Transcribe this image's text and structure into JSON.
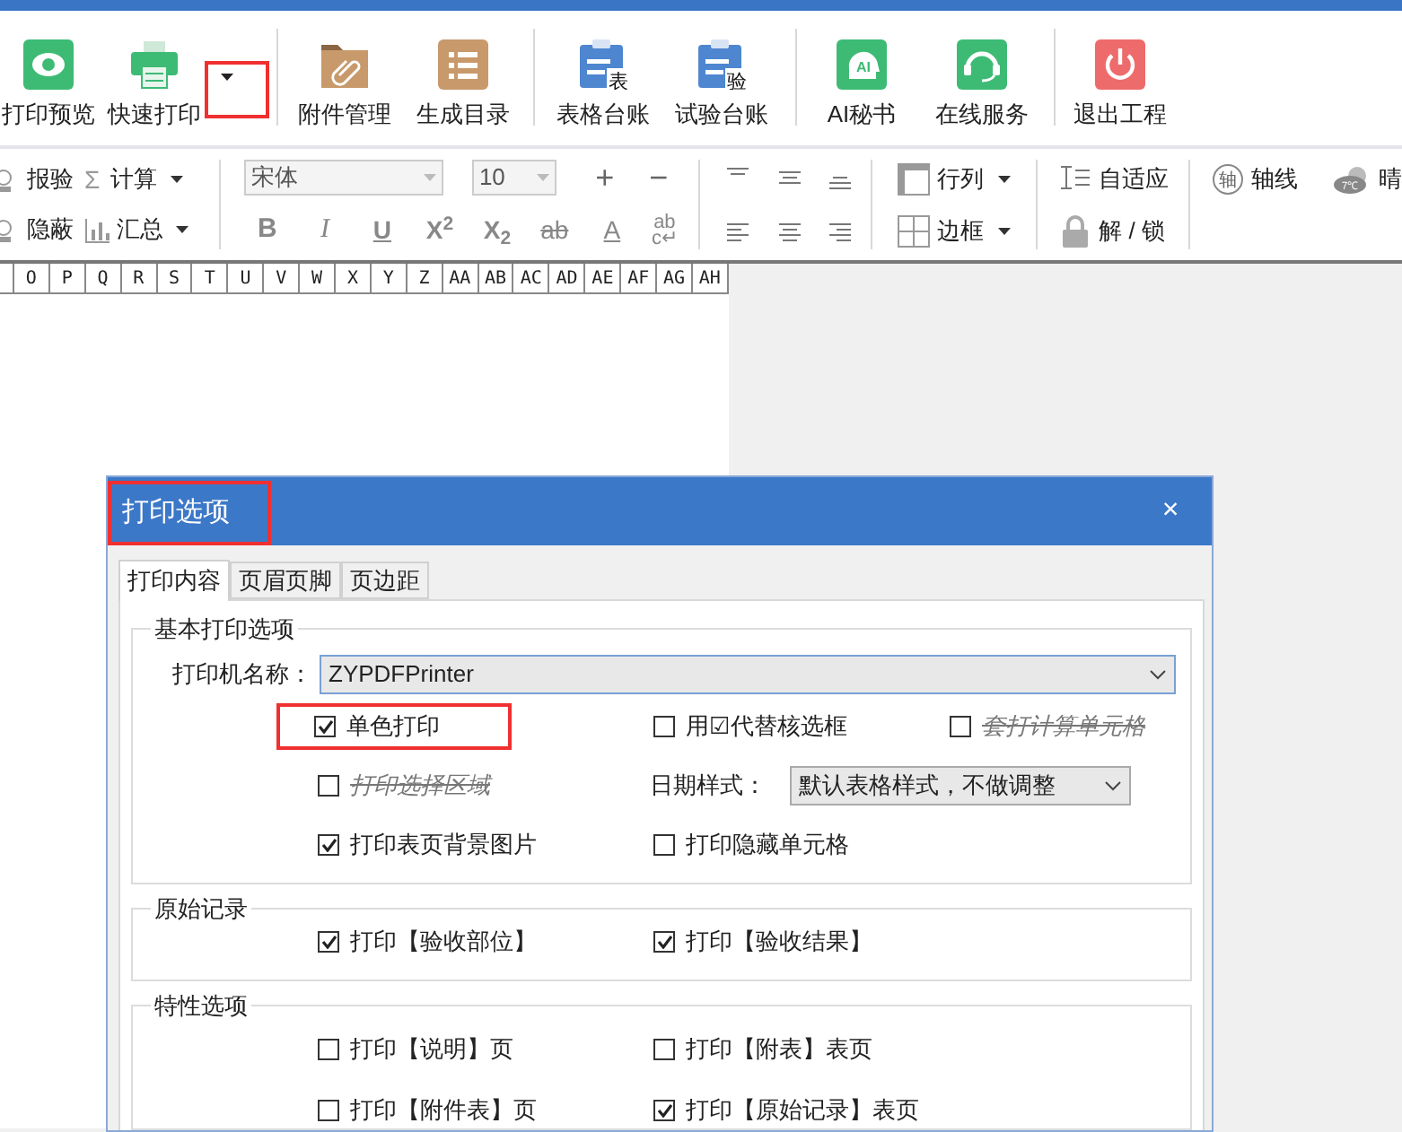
{
  "ribbon": {
    "items": [
      {
        "kind": "eye",
        "label": "打印预览"
      },
      {
        "kind": "printer",
        "label": "快速打印"
      },
      {
        "kind": "dropdown",
        "highlighted": true
      },
      {
        "kind": "separator"
      },
      {
        "kind": "folder",
        "label": "附件管理"
      },
      {
        "kind": "list",
        "label": "生成目录"
      },
      {
        "kind": "separator"
      },
      {
        "kind": "ledger",
        "label": "表格台账",
        "badge": "表"
      },
      {
        "kind": "ledger",
        "label": "试验台账",
        "badge": "验"
      },
      {
        "kind": "separator"
      },
      {
        "kind": "ai",
        "label": "AI秘书",
        "badge": "AI"
      },
      {
        "kind": "headset",
        "label": "在线服务"
      },
      {
        "kind": "separator"
      },
      {
        "kind": "power",
        "label": "退出工程"
      }
    ]
  },
  "format_bar": {
    "tools": [
      {
        "kind": "check",
        "label": "报验"
      },
      {
        "kind": "calc",
        "label": "计算",
        "symbol": "Σ"
      },
      {
        "kind": "hide",
        "label": "隐蔽"
      },
      {
        "kind": "sum",
        "label": "汇总"
      }
    ],
    "font": {
      "value": "宋体"
    },
    "size": {
      "value": "10"
    },
    "size_buttons": [
      "+",
      "−"
    ],
    "style_buttons": [
      {
        "kind": "bold",
        "label": "B"
      },
      {
        "kind": "italic",
        "label": "I"
      },
      {
        "kind": "underline",
        "label": "U"
      },
      {
        "kind": "plain",
        "label": "X$^{2}$"
      },
      {
        "kind": "plain",
        "label": "X$_{2}$"
      },
      {
        "kind": "strike",
        "label": "ab"
      },
      {
        "kind": "fontcolor",
        "label": "A"
      },
      {
        "kind": "wrap",
        "label": "ab",
        "sub": "c↵"
      }
    ],
    "layout_tools": [
      {
        "kind": "rowcol",
        "label": "行列"
      },
      {
        "kind": "border",
        "label": "边框"
      }
    ],
    "cell_tools": [
      {
        "kind": "fit",
        "label": "自适应"
      },
      {
        "kind": "lock",
        "label": "解 / 锁"
      }
    ],
    "extras": [
      {
        "kind": "axis",
        "label": "轴线",
        "badge": "轴"
      },
      {
        "kind": "weather",
        "label": "晴",
        "badge": "7℃"
      }
    ]
  },
  "sheet": {
    "columns": [
      "O",
      "P",
      "Q",
      "R",
      "S",
      "T",
      "U",
      "V",
      "W",
      "X",
      "Y",
      "Z",
      "AA",
      "AB",
      "AC",
      "AD",
      "AE",
      "AF",
      "AG",
      "AH"
    ]
  },
  "dialog": {
    "title": "打印选项",
    "title_highlighted": true,
    "close": "×",
    "tabs": [
      {
        "label": "打印内容",
        "selected": true
      },
      {
        "label": "页眉页脚",
        "selected": false
      },
      {
        "label": "页边距",
        "selected": false
      }
    ],
    "sections": [
      {
        "legend": "基本打印选项",
        "printer": {
          "label": "打印机名称：",
          "value": "ZYPDFPrinter"
        },
        "rows": [
          [
            {
              "kind": "checkbox",
              "label": "单色打印",
              "checked": true,
              "disabled": false,
              "highlighted": true
            },
            {
              "kind": "checkbox",
              "label": "用☑代替核选框",
              "checked": false,
              "disabled": false,
              "highlighted": false
            },
            {
              "kind": "checkbox",
              "label": "套打计算单元格",
              "checked": false,
              "disabled": true,
              "highlighted": false
            }
          ],
          [
            {
              "kind": "checkbox",
              "label": "打印选择区域",
              "checked": false,
              "disabled": true,
              "highlighted": false
            },
            {
              "kind": "select",
              "label": "日期样式：",
              "value": "默认表格样式，不做调整"
            }
          ],
          [
            {
              "kind": "checkbox",
              "label": "打印表页背景图片",
              "checked": true,
              "disabled": false,
              "highlighted": false
            },
            {
              "kind": "checkbox",
              "label": "打印隐藏单元格",
              "checked": false,
              "disabled": false,
              "highlighted": false
            }
          ]
        ]
      },
      {
        "legend": "原始记录",
        "rows": [
          [
            {
              "kind": "checkbox",
              "label": "打印【验收部位】",
              "checked": true,
              "disabled": false,
              "highlighted": false
            },
            {
              "kind": "checkbox",
              "label": "打印【验收结果】",
              "checked": true,
              "disabled": false,
              "highlighted": false
            }
          ]
        ]
      },
      {
        "legend": "特性选项",
        "rows": [
          [
            {
              "kind": "checkbox",
              "label": "打印【说明】页",
              "checked": false,
              "disabled": false,
              "highlighted": false
            },
            {
              "kind": "checkbox",
              "label": "打印【附表】表页",
              "checked": false,
              "disabled": false,
              "highlighted": false
            }
          ],
          [
            {
              "kind": "checkbox",
              "label": "打印【附件表】页",
              "checked": false,
              "disabled": false,
              "highlighted": false
            },
            {
              "kind": "checkbox",
              "label": "打印【原始记录】表页",
              "checked": true,
              "disabled": false,
              "highlighted": false
            }
          ]
        ]
      }
    ]
  }
}
